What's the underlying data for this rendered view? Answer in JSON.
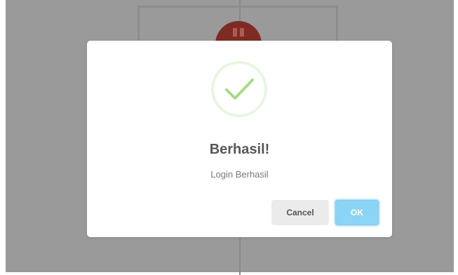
{
  "dialog": {
    "title": "Berhasil!",
    "message": "Login Berhasil",
    "cancel_label": "Cancel",
    "ok_label": "OK",
    "icon": "checkmark-success-icon"
  },
  "colors": {
    "overlay": "#9a9a9a",
    "success_green": "#a5dc86",
    "ok_button": "#8cd4f5",
    "cancel_button": "#ebebeb",
    "title_text": "#575757",
    "avatar_red": "#7e2b24"
  }
}
